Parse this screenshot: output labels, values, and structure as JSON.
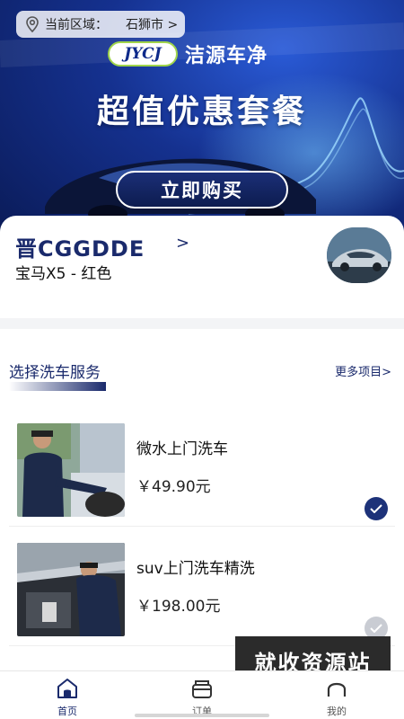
{
  "banner": {
    "region_label": "当前区域：",
    "region_value": "石狮市 >",
    "logo_mark": "JYCJ",
    "logo_name": "洁源车净",
    "headline": "超值优惠套餐",
    "buy_label": "立即购买"
  },
  "vehicle": {
    "plate": "晋CGGDDE",
    "arrow": ">",
    "model": "宝马X5 - 红色"
  },
  "services": {
    "title": "选择洗车服务",
    "more": "更多项目>",
    "items": [
      {
        "name": "微水上门洗车",
        "price": "￥49.90元",
        "selected": true
      },
      {
        "name": "suv上门洗车精洗",
        "price": "￥198.00元",
        "selected": false
      }
    ]
  },
  "watermark": "就收资源站",
  "tabs": [
    {
      "label": "首页",
      "icon": "home-icon",
      "active": true
    },
    {
      "label": "订单",
      "icon": "order-icon",
      "active": false
    },
    {
      "label": "我的",
      "icon": "profile-icon",
      "active": false
    }
  ],
  "colors": {
    "brand": "#1a2a6c",
    "check_on": "#1d3279",
    "check_off": "#c9ccd3"
  }
}
